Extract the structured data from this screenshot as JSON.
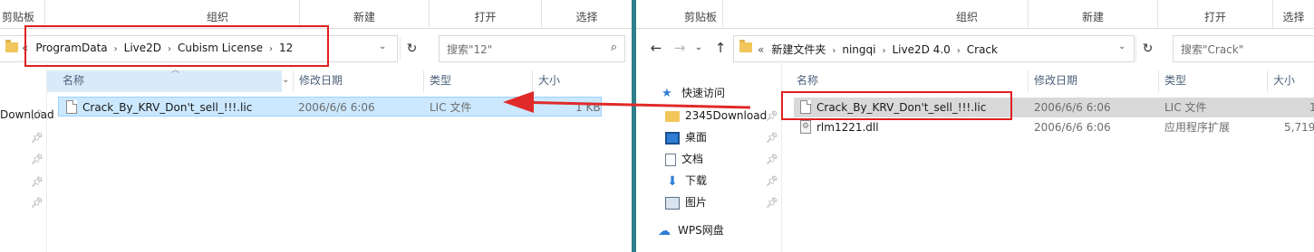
{
  "left": {
    "ribbon": [
      "剪贴板",
      "组织",
      "新建",
      "打开",
      "选择"
    ],
    "address": {
      "overflow": "«",
      "crumbs": [
        "ProgramData",
        "Live2D",
        "Cubism License",
        "12"
      ]
    },
    "search_placeholder": "搜索\"12\"",
    "columns": {
      "name": "名称",
      "date": "修改日期",
      "type": "类型",
      "size": "大小"
    },
    "files": [
      {
        "name": "Crack_By_KRV_Don't_sell_!!!.lic",
        "date": "2006/6/6 6:06",
        "type": "LIC 文件",
        "size": "1 KB"
      }
    ],
    "nav_partial": "Download"
  },
  "right": {
    "ribbon": [
      "剪贴板",
      "组织",
      "新建",
      "打开",
      "选择"
    ],
    "address": {
      "overflow": "«",
      "crumbs": [
        "新建文件夹",
        "ningqi",
        "Live2D 4.0",
        "Crack"
      ]
    },
    "search_placeholder": "搜索\"Crack\"",
    "columns": {
      "name": "名称",
      "date": "修改日期",
      "type": "类型",
      "size": "大小"
    },
    "files": [
      {
        "name": "Crack_By_KRV_Don't_sell_!!!.lic",
        "date": "2006/6/6 6:06",
        "type": "LIC 文件",
        "size": "1"
      },
      {
        "name": "rlm1221.dll",
        "date": "2006/6/6 6:06",
        "type": "应用程序扩展",
        "size": "5,719"
      }
    ],
    "nav": {
      "quick_access": "快速访问",
      "items": [
        {
          "label": "2345Download",
          "icon": "folder-icon"
        },
        {
          "label": "桌面",
          "icon": "desktop-icon"
        },
        {
          "label": "文档",
          "icon": "document-icon"
        },
        {
          "label": "下载",
          "icon": "download-icon"
        },
        {
          "label": "图片",
          "icon": "pictures-icon"
        }
      ],
      "wps": "WPS网盘"
    }
  },
  "colors": {
    "annotation_red": "#e02020",
    "selection": "#cce8ff",
    "divider": "#2d7f8a"
  }
}
